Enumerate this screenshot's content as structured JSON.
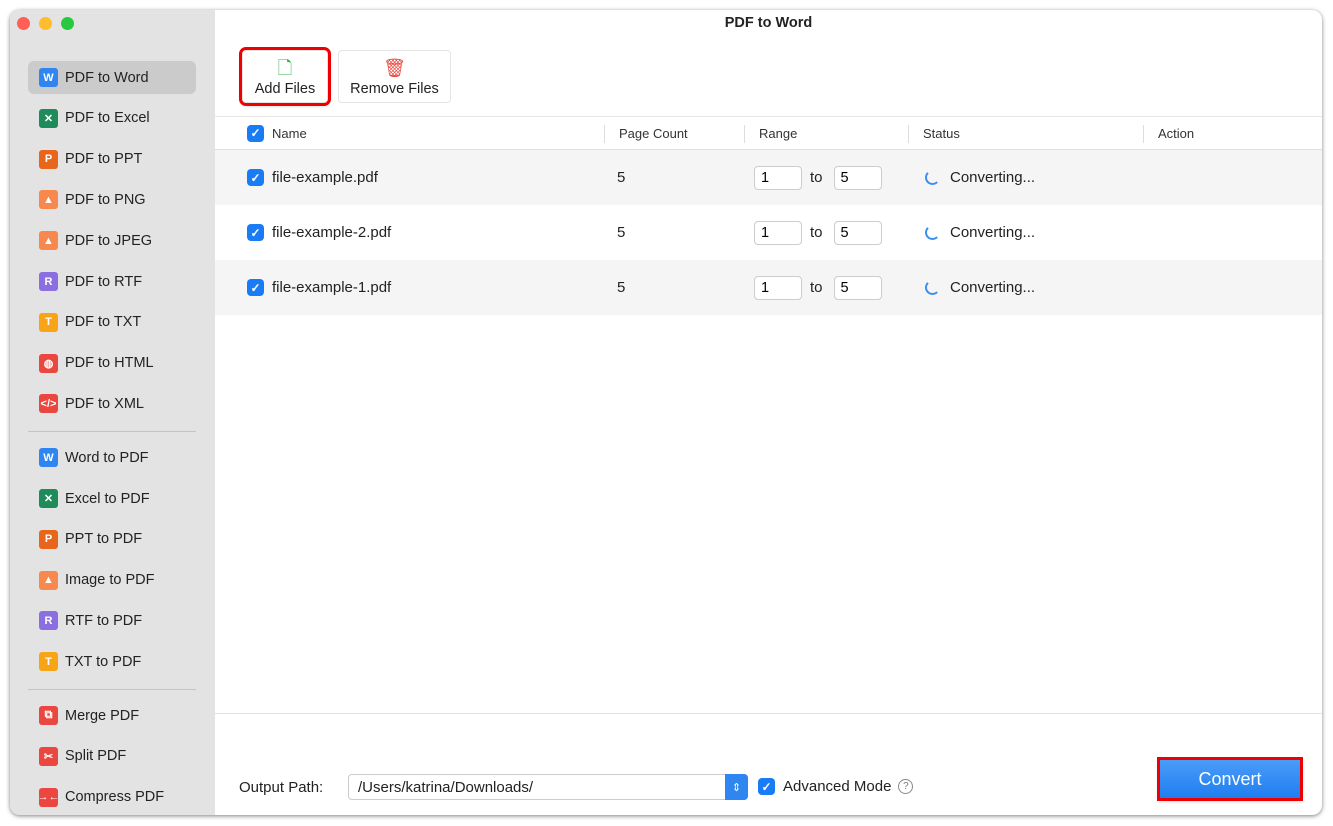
{
  "window": {
    "title": "PDF to Word"
  },
  "sidebar": {
    "groups": [
      [
        {
          "label": "PDF to Word",
          "icon": "W",
          "color": "#2f86f0",
          "active": true
        },
        {
          "label": "PDF to Excel",
          "icon": "✕",
          "color": "#1f8a5a"
        },
        {
          "label": "PDF to PPT",
          "icon": "P",
          "color": "#e8651c"
        },
        {
          "label": "PDF to PNG",
          "icon": "▲",
          "color": "#f7884e"
        },
        {
          "label": "PDF to JPEG",
          "icon": "▲",
          "color": "#f7884e"
        },
        {
          "label": "PDF to RTF",
          "icon": "R",
          "color": "#8b6fe0"
        },
        {
          "label": "PDF to TXT",
          "icon": "T",
          "color": "#f7a516"
        },
        {
          "label": "PDF to HTML",
          "icon": "◍",
          "color": "#e9473f"
        },
        {
          "label": "PDF to XML",
          "icon": "</>",
          "color": "#e9473f"
        }
      ],
      [
        {
          "label": "Word to PDF",
          "icon": "W",
          "color": "#2f86f0"
        },
        {
          "label": "Excel to PDF",
          "icon": "✕",
          "color": "#1f8a5a"
        },
        {
          "label": "PPT to PDF",
          "icon": "P",
          "color": "#e8651c"
        },
        {
          "label": "Image to PDF",
          "icon": "▲",
          "color": "#f7884e"
        },
        {
          "label": "RTF to PDF",
          "icon": "R",
          "color": "#8b6fe0"
        },
        {
          "label": "TXT to PDF",
          "icon": "T",
          "color": "#f7a516"
        }
      ],
      [
        {
          "label": "Merge PDF",
          "icon": "⧉",
          "color": "#e9473f"
        },
        {
          "label": "Split PDF",
          "icon": "✂",
          "color": "#e9473f"
        },
        {
          "label": "Compress PDF",
          "icon": "→←",
          "color": "#e9473f"
        }
      ]
    ]
  },
  "toolbar": {
    "add_files": "Add Files",
    "remove_files": "Remove Files"
  },
  "table": {
    "headers": {
      "name": "Name",
      "page_count": "Page Count",
      "range": "Range",
      "status": "Status",
      "action": "Action"
    },
    "range_sep": "to",
    "rows": [
      {
        "name": "file-example.pdf",
        "pages": "5",
        "from": "1",
        "to": "5",
        "status": "Converting..."
      },
      {
        "name": "file-example-2.pdf",
        "pages": "5",
        "from": "1",
        "to": "5",
        "status": "Converting..."
      },
      {
        "name": "file-example-1.pdf",
        "pages": "5",
        "from": "1",
        "to": "5",
        "status": "Converting..."
      }
    ]
  },
  "footer": {
    "output_label": "Output Path:",
    "output_path": "/Users/katrina/Downloads/",
    "advanced_mode": "Advanced Mode",
    "convert": "Convert"
  }
}
